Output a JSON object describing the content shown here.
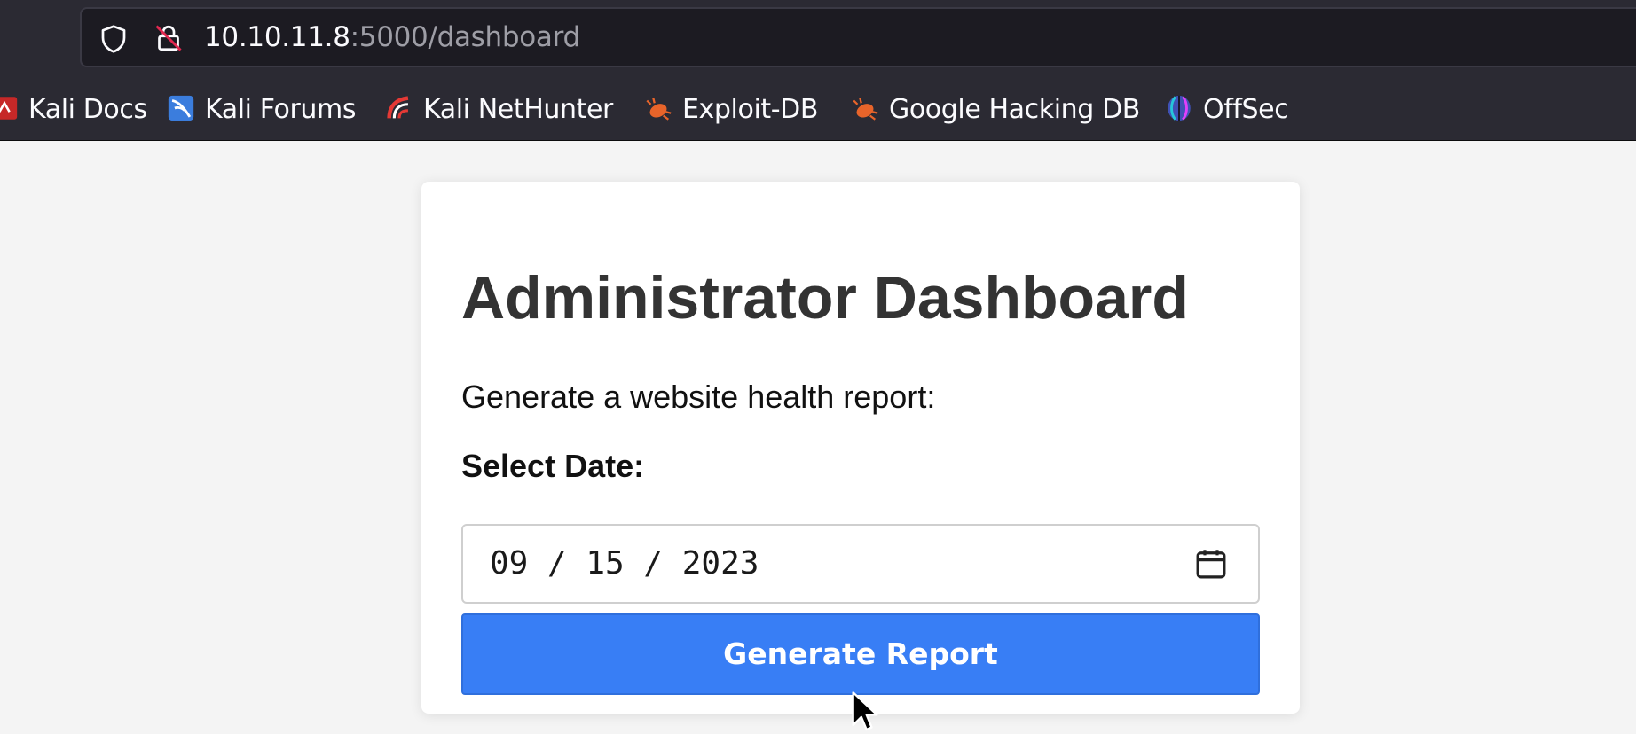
{
  "browser": {
    "url_host": "10.10.11.8",
    "url_rest": ":5000/dashboard",
    "bookmarks": [
      {
        "label": "Kali Docs",
        "icon": "kali-docs-icon"
      },
      {
        "label": "Kali Forums",
        "icon": "kali-forums-icon"
      },
      {
        "label": "Kali NetHunter",
        "icon": "kali-nethunter-icon"
      },
      {
        "label": "Exploit-DB",
        "icon": "exploit-db-icon"
      },
      {
        "label": "Google Hacking DB",
        "icon": "google-hacking-db-icon"
      },
      {
        "label": "OffSec",
        "icon": "offsec-icon"
      }
    ]
  },
  "page": {
    "title": "Administrator Dashboard",
    "description": "Generate a website health report:",
    "date_label": "Select Date:",
    "date_value": "09 / 15 / 2023",
    "button_label": "Generate Report"
  },
  "colors": {
    "button": "#387ef5",
    "chrome": "#2b2a33",
    "urlbar": "#1c1b22",
    "page_bg": "#f4f4f4"
  }
}
